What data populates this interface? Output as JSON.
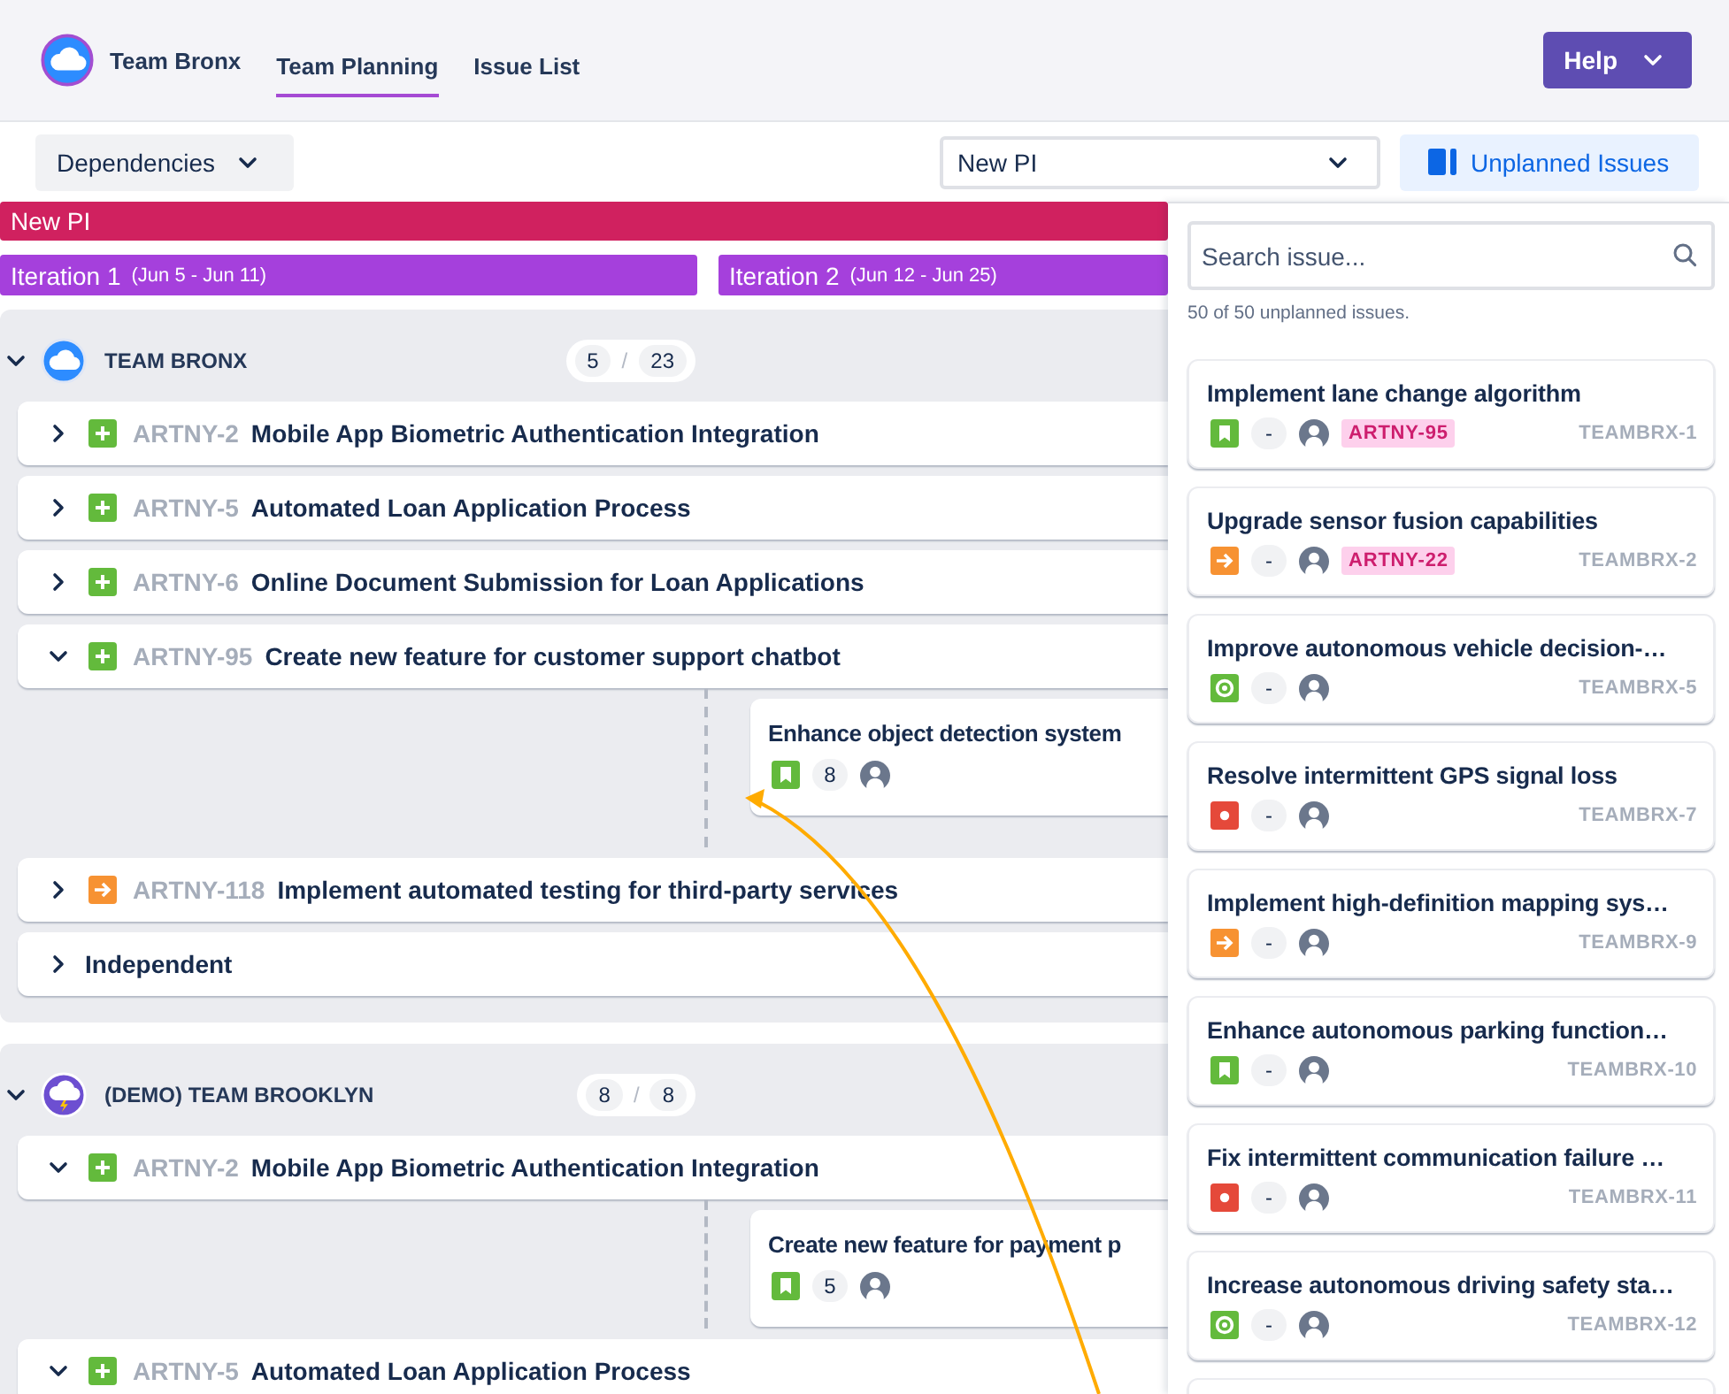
{
  "nav": {
    "team": "Team Bronx",
    "tabs": [
      {
        "label": "Team Planning",
        "selected": true
      },
      {
        "label": "Issue List",
        "selected": false
      }
    ],
    "help": "Help"
  },
  "toolbar": {
    "dependencies": "Dependencies",
    "pi_select": "New PI",
    "unplanned_button": "Unplanned Issues"
  },
  "pi": {
    "name": "New PI",
    "iterations": [
      {
        "name": "Iteration 1",
        "dates": "(Jun 5 - Jun 11)"
      },
      {
        "name": "Iteration 2",
        "dates": "(Jun 12 - Jun 25)"
      }
    ]
  },
  "teams": [
    {
      "name": "TEAM BRONX",
      "avatar": {
        "kind": "cloud"
      },
      "expanded": true,
      "planned": "5",
      "separator": "/",
      "total": "23",
      "rows": [
        {
          "key": "ARTNY-2",
          "title": "Mobile App Biometric Authentication Integration",
          "kind": "feature",
          "expanded": false
        },
        {
          "key": "ARTNY-5",
          "title": "Automated Loan Application Process",
          "kind": "feature",
          "expanded": false
        },
        {
          "key": "ARTNY-6",
          "title": "Online Document Submission for Loan Applications",
          "kind": "feature",
          "expanded": false
        },
        {
          "key": "ARTNY-95",
          "title": "Create new feature for customer support chatbot",
          "kind": "feature",
          "expanded": true,
          "children": [
            {
              "title": "Enhance object detection system",
              "kind": "story",
              "estimate": "8"
            }
          ]
        },
        {
          "key": "ARTNY-118",
          "title": "Implement automated testing for third-party services",
          "kind": "improvement",
          "expanded": false
        },
        {
          "title": "Independent",
          "expanded": false
        }
      ]
    },
    {
      "name": "(DEMO) TEAM BROOKLYN",
      "avatar": {
        "kind": "storm"
      },
      "expanded": true,
      "planned": "8",
      "separator": "/",
      "total": "8",
      "rows": [
        {
          "key": "ARTNY-2",
          "title": "Mobile App Biometric Authentication Integration",
          "kind": "feature",
          "expanded": true,
          "children": [
            {
              "title": "Create new feature for payment p",
              "kind": "story",
              "estimate": "5"
            }
          ]
        },
        {
          "key": "ARTNY-5",
          "title": "Automated Loan Application Process",
          "kind": "feature",
          "expanded": true
        }
      ]
    }
  ],
  "panel": {
    "search_placeholder": "Search issue...",
    "count": "50 of 50 unplanned issues.",
    "more_below": true,
    "issues": [
      {
        "title": "Implement lane change algorithm",
        "kind": "story",
        "estimate": "-",
        "tag": "ARTNY-95",
        "key": "TEAMBRX-1"
      },
      {
        "title": "Upgrade sensor fusion capabilities",
        "kind": "improvement",
        "estimate": "-",
        "tag": "ARTNY-22",
        "key": "TEAMBRX-2"
      },
      {
        "title": "Improve autonomous vehicle decision-…",
        "kind": "task",
        "estimate": "-",
        "key": "TEAMBRX-5"
      },
      {
        "title": "Resolve intermittent GPS signal loss",
        "kind": "bug",
        "estimate": "-",
        "key": "TEAMBRX-7"
      },
      {
        "title": "Implement high-definition mapping sys…",
        "kind": "improvement",
        "estimate": "-",
        "key": "TEAMBRX-9"
      },
      {
        "title": "Enhance autonomous parking function…",
        "kind": "story",
        "estimate": "-",
        "key": "TEAMBRX-10"
      },
      {
        "title": "Fix intermittent communication failure …",
        "kind": "bug",
        "estimate": "-",
        "key": "TEAMBRX-11"
      },
      {
        "title": "Increase autonomous driving safety sta…",
        "kind": "task",
        "estimate": "-",
        "key": "TEAMBRX-12"
      }
    ]
  }
}
